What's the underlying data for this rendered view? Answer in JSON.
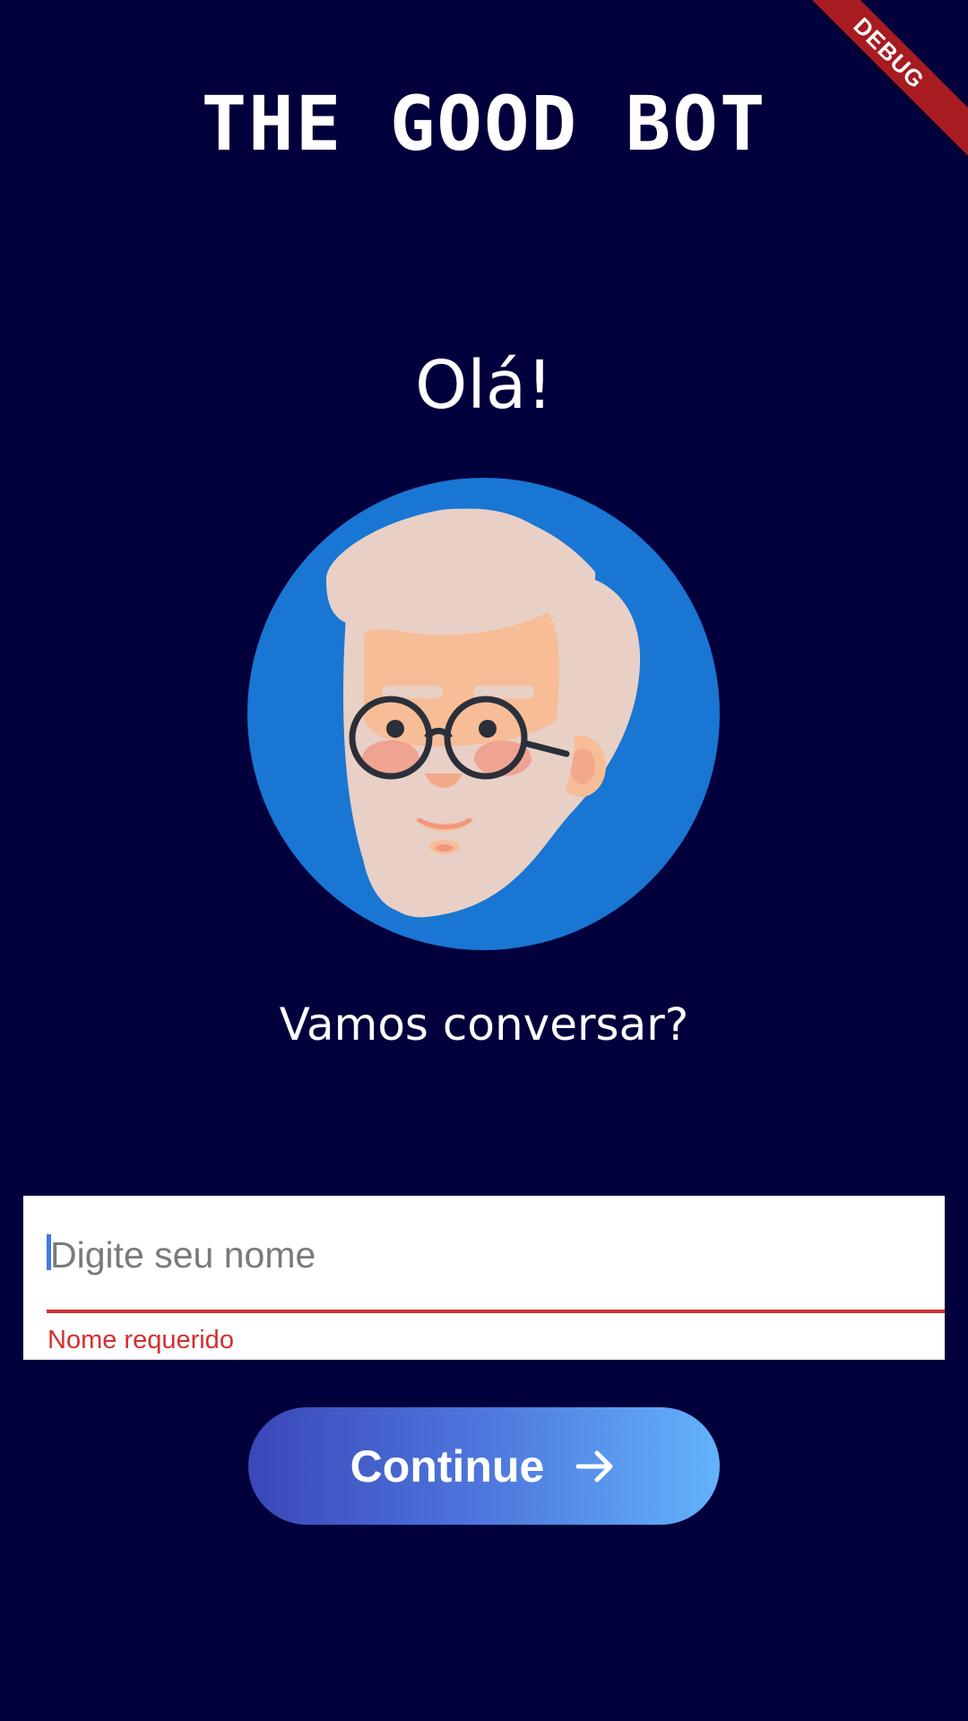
{
  "debug_banner": "DEBUG",
  "app": {
    "title": "THE GOOD BOT"
  },
  "greeting": "Olá!",
  "avatar": {
    "icon": "old-man-with-glasses-icon",
    "background_color": "#1976d2"
  },
  "subtitle": "Vamos conversar?",
  "name_field": {
    "placeholder": "Digite seu nome",
    "value": "",
    "error": "Nome requerido"
  },
  "continue_button": {
    "label": "Continue",
    "icon": "arrow-right-icon"
  },
  "colors": {
    "background": "#01003d",
    "error": "#d32f2f",
    "button_gradient_start": "#3a47b8",
    "button_gradient_end": "#63b3fb",
    "debug_ribbon": "#a81b20"
  }
}
